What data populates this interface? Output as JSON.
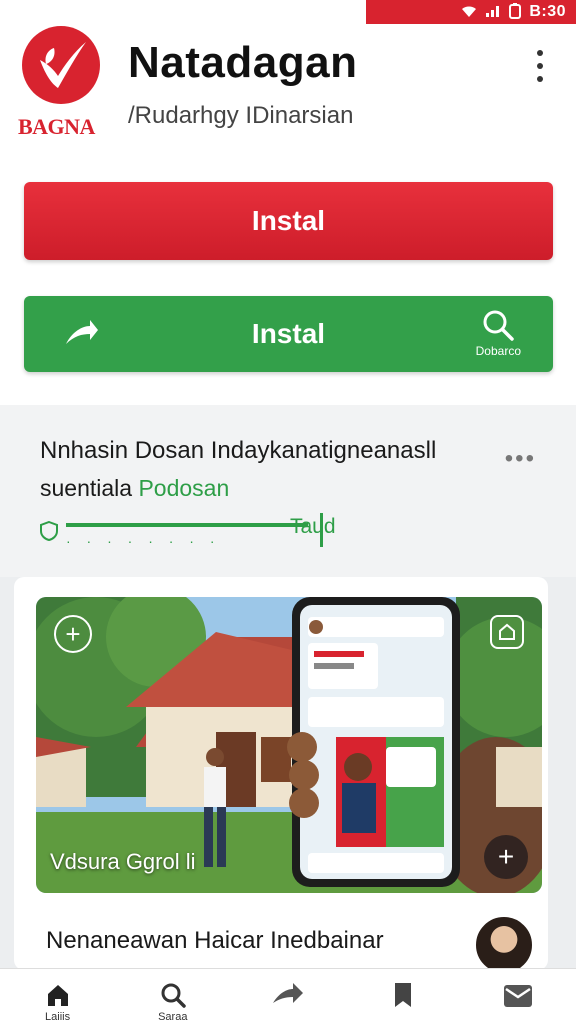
{
  "status_bar": {
    "time": "B:30",
    "icons": [
      "wifi-icon",
      "signal-icon",
      "battery-icon"
    ],
    "background": "#d8232f"
  },
  "header": {
    "logo_text": "BAGNA",
    "title": "Natadagan",
    "subtitle": "/Rudarhgy IDinarsian"
  },
  "actions": {
    "install_primary": "Instal",
    "install_secondary": "Instal",
    "secondary_right_label": "Dobarco"
  },
  "post": {
    "title": "Nnhasin Dosan Indaykanatigneanasll",
    "subtitle_plain": "suentiala",
    "subtitle_green": "Podosan",
    "tag": "Taud",
    "more": "•••"
  },
  "card": {
    "photo_caption": "Vdsura Ggrol li",
    "title": "Nenaneawan  Haicar Inedbainar"
  },
  "bottom_nav": {
    "items": [
      {
        "label": "Laiiis",
        "icon": "home-icon"
      },
      {
        "label": "Saraa",
        "icon": "search-icon"
      },
      {
        "label": "",
        "icon": "share-icon"
      },
      {
        "label": "",
        "icon": "bookmark-icon"
      },
      {
        "label": "",
        "icon": "mail-icon"
      }
    ]
  },
  "colors": {
    "brand_red": "#d8232f",
    "brand_green": "#33a04a"
  }
}
